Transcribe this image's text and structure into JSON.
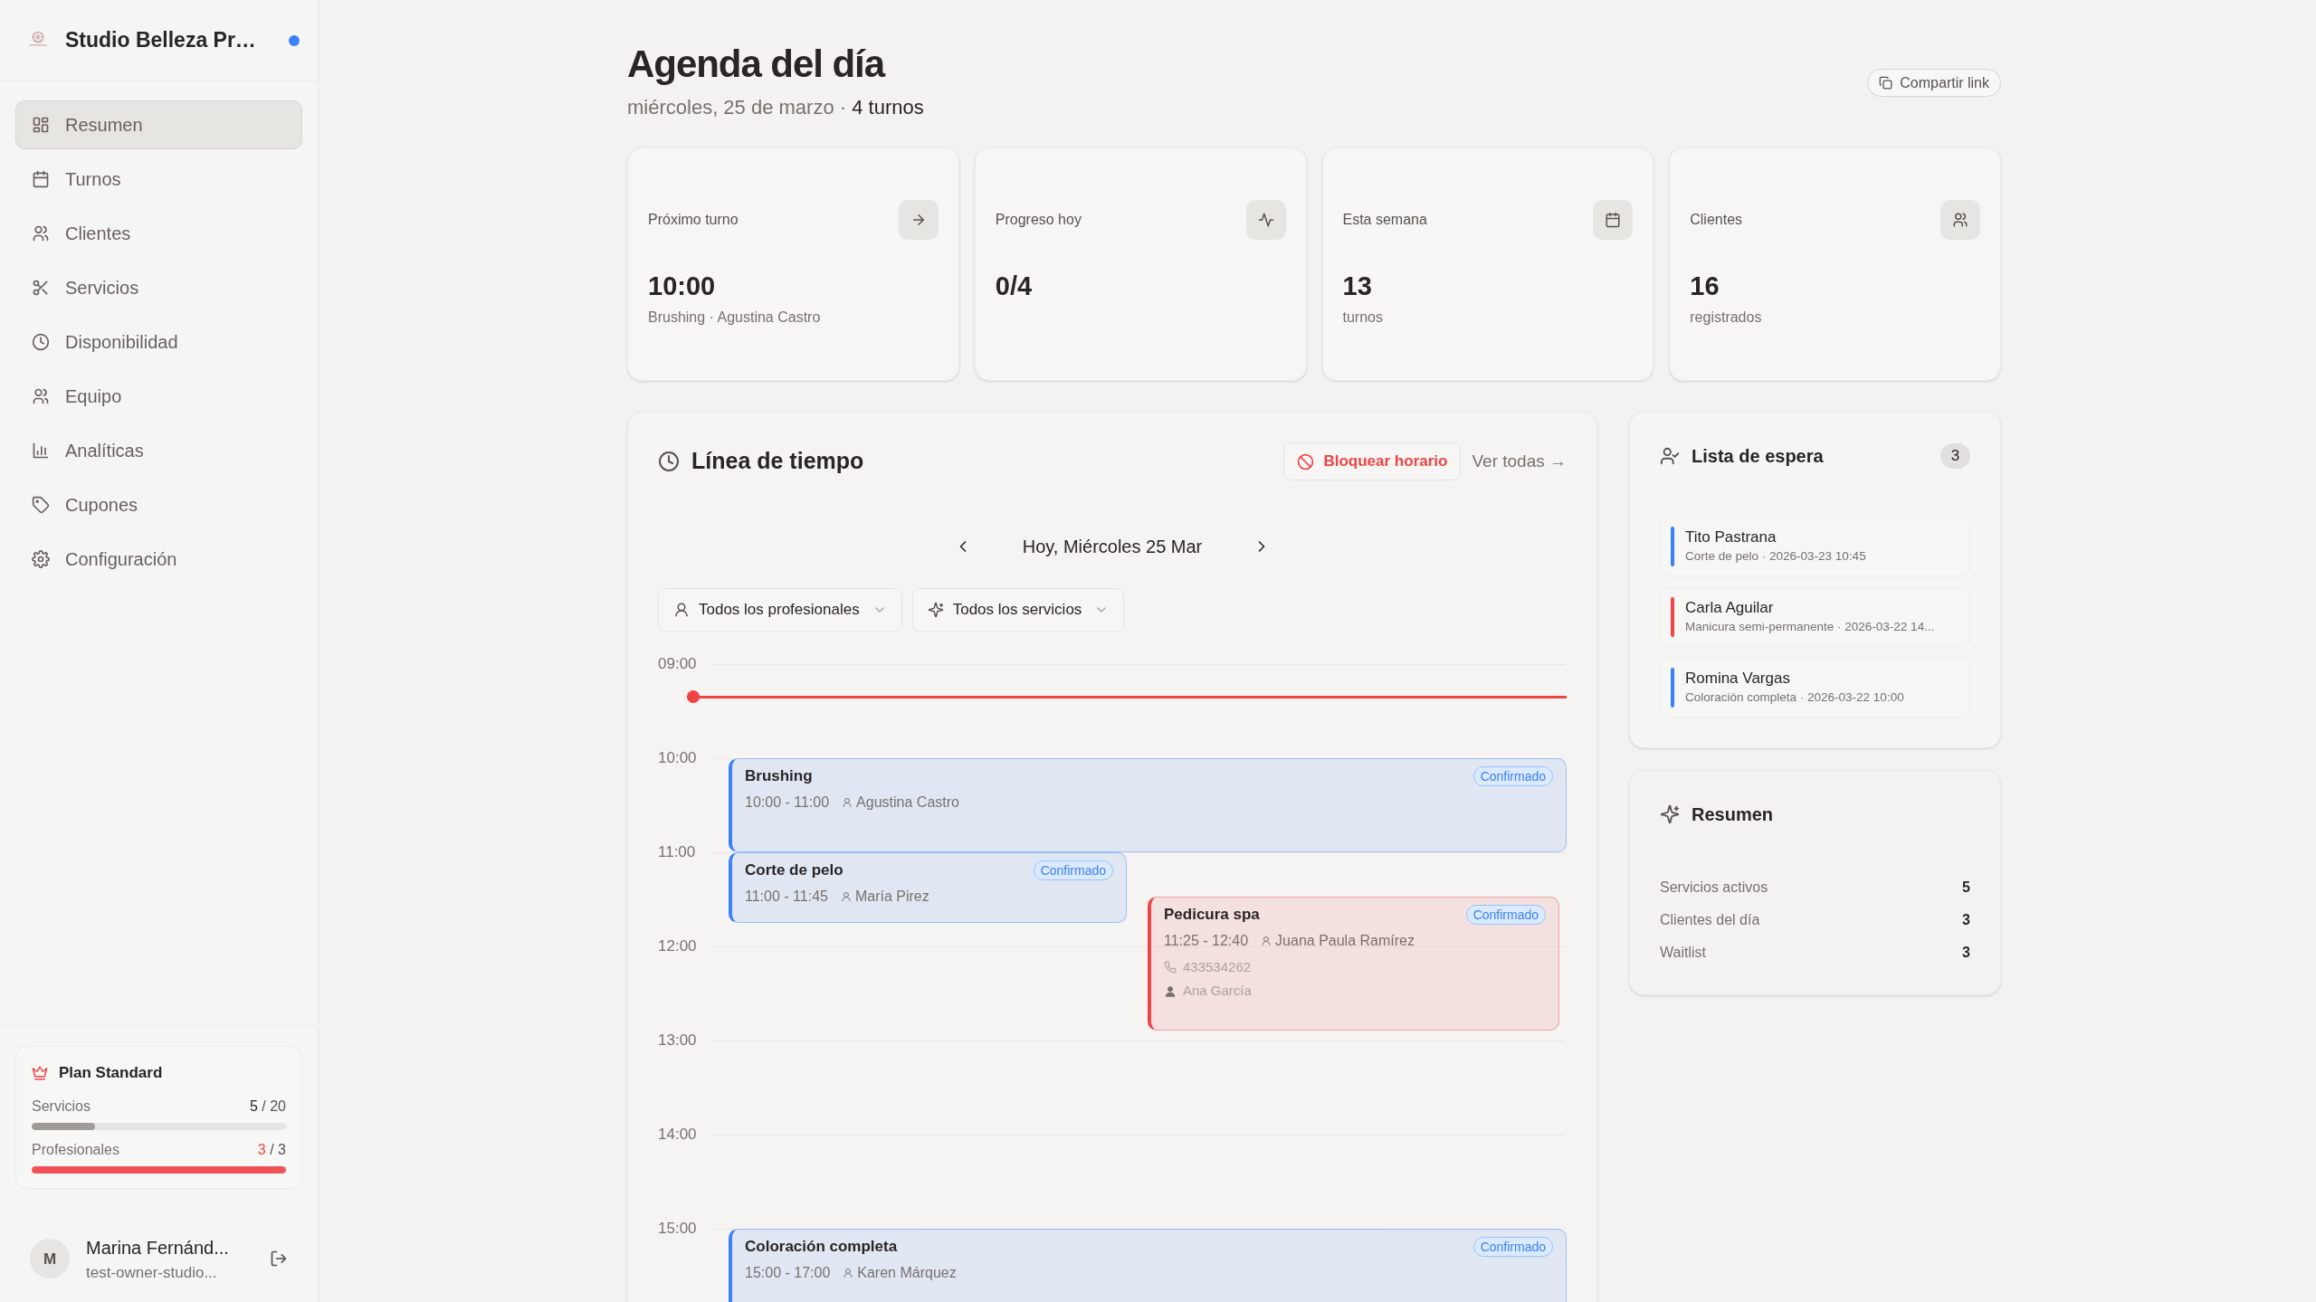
{
  "sidebar": {
    "business_name": "Studio Belleza Pr…",
    "notification": true,
    "items": [
      {
        "label": "Resumen",
        "selected": true
      },
      {
        "label": "Turnos",
        "selected": false
      },
      {
        "label": "Clientes",
        "selected": false
      },
      {
        "label": "Servicios",
        "selected": false
      },
      {
        "label": "Disponibilidad",
        "selected": false
      },
      {
        "label": "Equipo",
        "selected": false
      },
      {
        "label": "Analíticas",
        "selected": false
      },
      {
        "label": "Cupones",
        "selected": false
      },
      {
        "label": "Configuración",
        "selected": false
      }
    ],
    "plan": {
      "title": "Plan Standard",
      "limits": [
        {
          "label": "Servicios",
          "used": "5",
          "total": "/ 20",
          "level": 0.25
        },
        {
          "label": "Profesionales",
          "used": "3",
          "total": "/ 3",
          "level": 1
        }
      ]
    },
    "user": {
      "initial": "M",
      "name": "Marina Fernánd...",
      "email": "test-owner-studio..."
    }
  },
  "header": {
    "title": "Agenda del día",
    "date": "miércoles, 25 de marzo ·",
    "count": "4 turnos",
    "share_button": "Compartir link"
  },
  "stats": [
    {
      "label": "Próximo turno",
      "value": "10:00",
      "detail": "Brushing · Agustina Castro"
    },
    {
      "label": "Progreso hoy",
      "value": "0/4"
    },
    {
      "label": "Esta semana",
      "value": "13",
      "detail": "turnos"
    },
    {
      "label": "Clientes",
      "value": "16",
      "detail": "registrados"
    }
  ],
  "timeline": {
    "title": "Línea de tiempo",
    "block_button": "Bloquear horario",
    "view_all": "Ver todas →",
    "day": "Hoy, Miércoles 25 Mar",
    "filters": [
      "Todos los profesionales",
      "Todos los servicios"
    ],
    "hours": [
      "09:00",
      "10:00",
      "11:00",
      "12:00",
      "13:00",
      "14:00",
      "15:00"
    ],
    "now_marker": {
      "level": 0.052
    },
    "events": [
      {
        "title": "Brushing",
        "time": "10:00 - 11:00",
        "client": "Agustina Castro",
        "status": "Confirmado",
        "color": "#3b82f6"
      },
      {
        "title": "Corte de pelo",
        "time": "11:00 - 11:45",
        "client": "María Pirez",
        "status": "Confirmado",
        "color": "#3b82f6"
      },
      {
        "title": "Pedicura spa",
        "time": "11:25 - 12:40",
        "client": "Juana Paula Ramírez",
        "phone": "433534262",
        "staff": "Ana García",
        "status": "Confirmado",
        "color": "#ef4444"
      },
      {
        "title": "Coloración completa",
        "time": "15:00 - 17:00",
        "client": "Karen Márquez",
        "status": "Confirmado",
        "color": "#3b82f6"
      }
    ]
  },
  "waitlist": {
    "title": "Lista de espera",
    "count": "3",
    "items": [
      {
        "name": "Tito Pastrana",
        "detail": "Corte de pelo · 2026-03-23 10:45",
        "color": "#3b82f6"
      },
      {
        "name": "Carla Aguilar",
        "detail": "Manicura semi-permanente · 2026-03-22 14...",
        "color": "#ef4444"
      },
      {
        "name": "Romina Vargas",
        "detail": "Coloración completa · 2026-03-22 10:00",
        "color": "#3b82f6"
      }
    ]
  },
  "summary": {
    "title": "Resumen",
    "rows": [
      {
        "label": "Servicios activos",
        "value": "5"
      },
      {
        "label": "Clientes del día",
        "value": "3"
      },
      {
        "label": "Waitlist",
        "value": "3"
      }
    ]
  }
}
